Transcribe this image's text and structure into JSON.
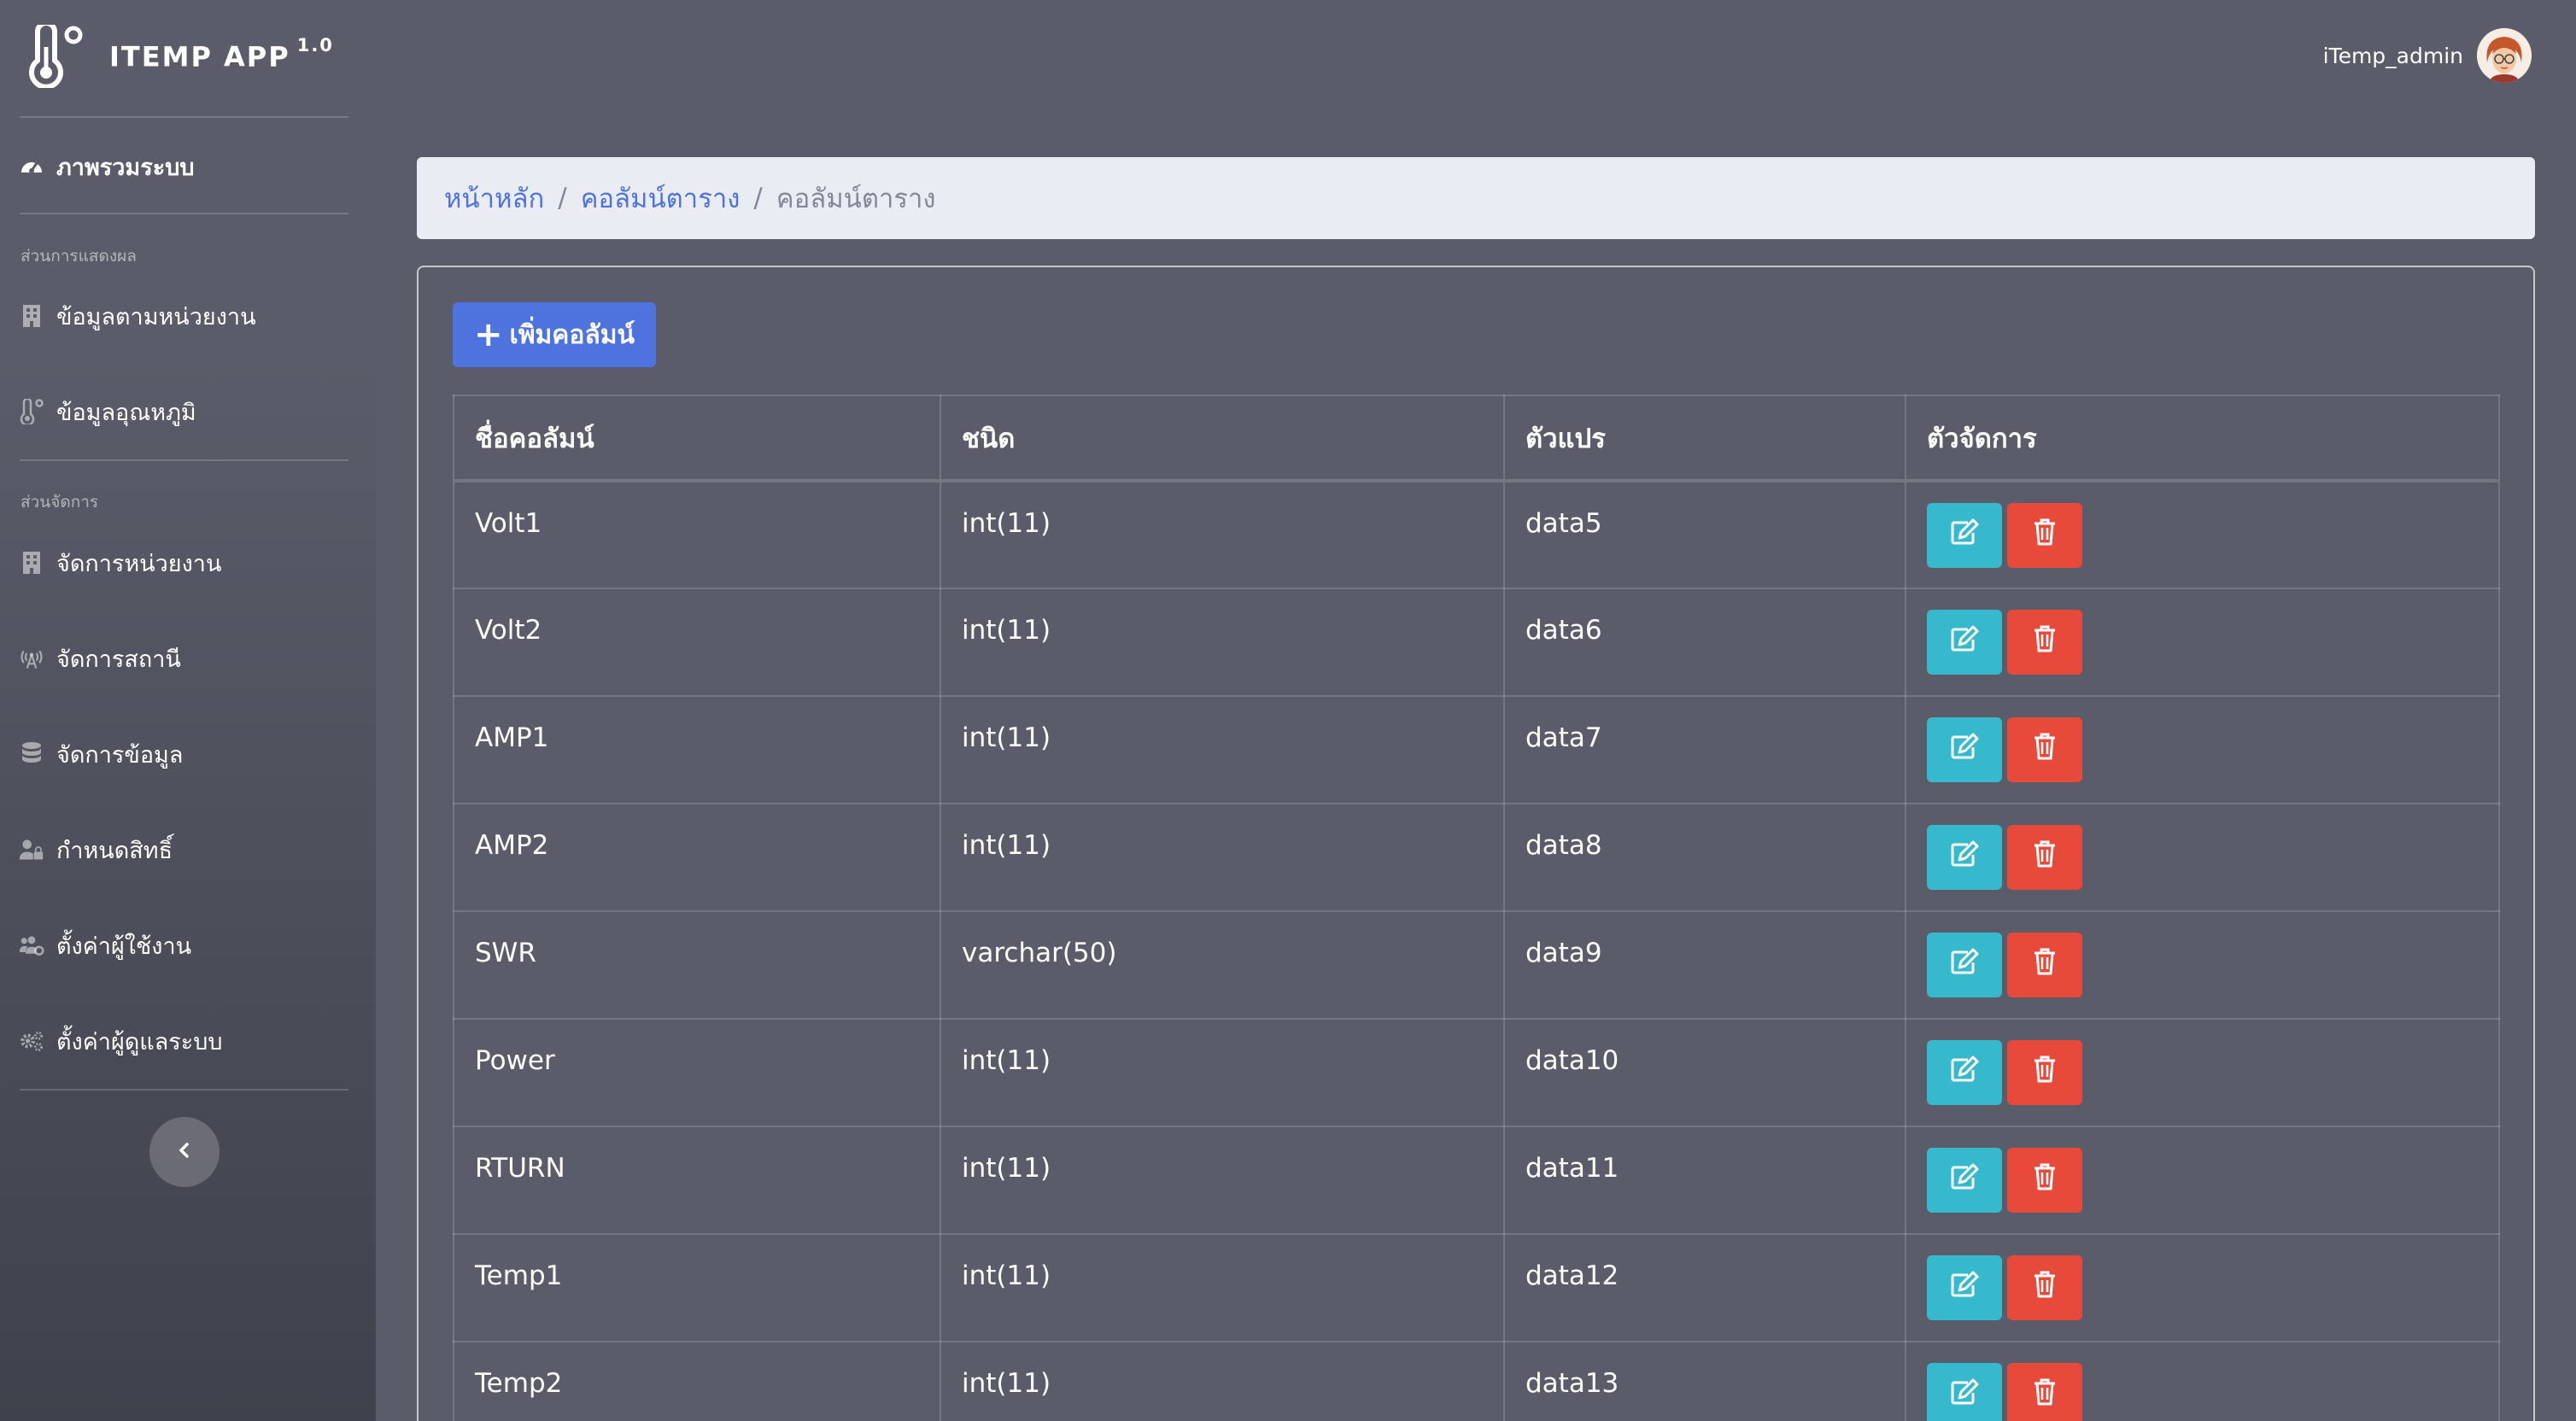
{
  "app": {
    "name": "ITEMP APP",
    "version": "1.0"
  },
  "user": {
    "name": "iTemp_admin"
  },
  "sidebar": {
    "dashboard": "ภาพรวมระบบ",
    "section_display": "ส่วนการแสดงผล",
    "display_items": [
      {
        "label": "ข้อมูลตามหน่วยงาน",
        "icon": "building-icon"
      },
      {
        "label": "ข้อมูลอุณหภูมิ",
        "icon": "thermometer-icon"
      }
    ],
    "section_manage": "ส่วนจัดการ",
    "manage_items": [
      {
        "label": "จัดการหน่วยงาน",
        "icon": "building-icon"
      },
      {
        "label": "จัดการสถานี",
        "icon": "broadcast-tower-icon"
      },
      {
        "label": "จัดการข้อมูล",
        "icon": "database-icon"
      },
      {
        "label": "กำหนดสิทธิ์",
        "icon": "user-lock-icon"
      },
      {
        "label": "ตั้งค่าผู้ใช้งาน",
        "icon": "users-cog-icon"
      },
      {
        "label": "ตั้งค่าผู้ดูแลระบบ",
        "icon": "cogs-icon"
      }
    ]
  },
  "breadcrumb": {
    "home": "หน้าหลัก",
    "parent": "คอลัมน์ตาราง",
    "current": "คอลัมน์ตาราง"
  },
  "actions": {
    "add_label": "เพิ่มคอลัมน์"
  },
  "table": {
    "headers": [
      "ชื่อคอลัมน์",
      "ชนิด",
      "ตัวแปร",
      "ตัวจัดการ"
    ],
    "rows": [
      [
        "Volt1",
        "int(11)",
        "data5"
      ],
      [
        "Volt2",
        "int(11)",
        "data6"
      ],
      [
        "AMP1",
        "int(11)",
        "data7"
      ],
      [
        "AMP2",
        "int(11)",
        "data8"
      ],
      [
        "SWR",
        "varchar(50)",
        "data9"
      ],
      [
        "Power",
        "int(11)",
        "data10"
      ],
      [
        "RTURN",
        "int(11)",
        "data11"
      ],
      [
        "Temp1",
        "int(11)",
        "data12"
      ],
      [
        "Temp2",
        "int(11)",
        "data13"
      ]
    ]
  },
  "colors": {
    "primary": "#4e73df",
    "info": "#36b9cc",
    "danger": "#e74a3b",
    "background": "#5a5c69",
    "breadcrumb_bg": "#eaecf4"
  }
}
